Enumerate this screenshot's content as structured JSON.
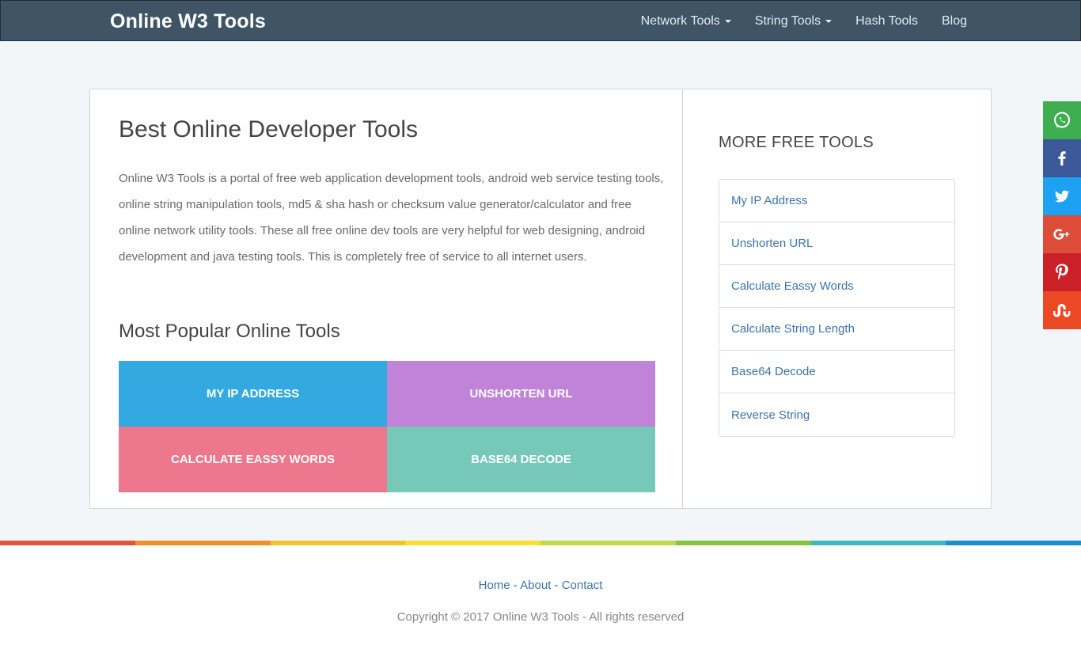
{
  "navbar": {
    "brand": "Online W3 Tools",
    "items": [
      {
        "label": "Network Tools",
        "dropdown": true
      },
      {
        "label": "String Tools",
        "dropdown": true
      },
      {
        "label": "Hash Tools",
        "dropdown": false
      },
      {
        "label": "Blog",
        "dropdown": false
      }
    ]
  },
  "main": {
    "title": "Best Online Developer Tools",
    "intro": "Online W3 Tools is a portal of free web application development tools, android web service testing tools, online string manipulation tools, md5 & sha hash or checksum value generator/calculator and free online network utility tools. These all free online dev tools are very helpful for web designing, android development and java testing tools. This is completely free of service to all internet users.",
    "popular_title": "Most Popular Online Tools",
    "tiles": [
      {
        "label": "MY IP ADDRESS",
        "color": "#33a9e1"
      },
      {
        "label": "UNSHORTEN URL",
        "color": "#c083d8"
      },
      {
        "label": "CALCULATE EASSY WORDS",
        "color": "#ed778c"
      },
      {
        "label": "BASE64 DECODE",
        "color": "#76c9b9"
      }
    ]
  },
  "sidebar": {
    "title": "MORE FREE TOOLS",
    "items": [
      {
        "label": "My IP Address"
      },
      {
        "label": "Unshorten URL"
      },
      {
        "label": "Calculate Eassy Words"
      },
      {
        "label": "Calculate String Length"
      },
      {
        "label": "Base64 Decode"
      },
      {
        "label": "Reverse String"
      }
    ]
  },
  "share": [
    {
      "icon": "whatsapp-icon",
      "color": "#3fae51"
    },
    {
      "icon": "facebook-icon",
      "color": "#3b5898"
    },
    {
      "icon": "twitter-icon",
      "color": "#1da1f2"
    },
    {
      "icon": "google-plus-icon",
      "color": "#dd4b39"
    },
    {
      "icon": "pinterest-icon",
      "color": "#cb2027"
    },
    {
      "icon": "stumbleupon-icon",
      "color": "#eb4924"
    }
  ],
  "rainbow": [
    "#e2523d",
    "#f0902b",
    "#f6c12f",
    "#f7e12e",
    "#c1d94a",
    "#86c440",
    "#3fb8c4",
    "#1b8ed0"
  ],
  "footer": {
    "links": [
      "Home",
      "About",
      "Contact"
    ],
    "separator": "-",
    "copyright": "Copyright © 2017 Online W3 Tools - All rights reserved"
  }
}
